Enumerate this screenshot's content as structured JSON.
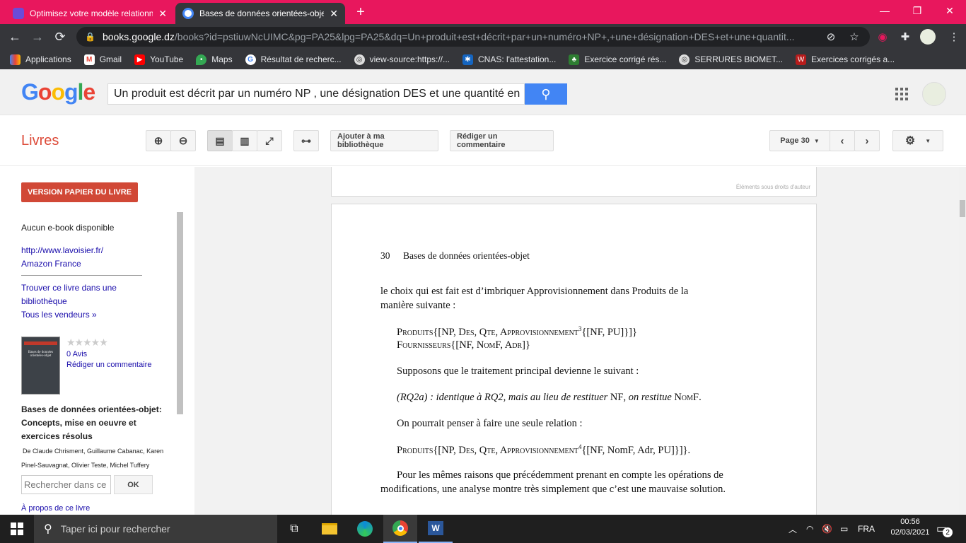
{
  "tabs": [
    {
      "title": "Optimisez votre modèle relationn",
      "close": "✕"
    },
    {
      "title": "Bases de données orientées-objet",
      "close": "✕"
    }
  ],
  "new_tab": "+",
  "window_controls": {
    "minimize": "—",
    "maximize": "❐",
    "close": "✕"
  },
  "address": {
    "host": "books.google.dz",
    "path": "/books?id=pstiuwNcUIMC&pg=PA25&lpg=PA25&dq=Un+produit+est+décrit+par+un+numéro+NP+,+une+désignation+DES+et+une+quantit..."
  },
  "bookmarks": [
    {
      "label": "Applications",
      "icon": "apps-grid-icon"
    },
    {
      "label": "Gmail",
      "icon": "gmail-icon"
    },
    {
      "label": "YouTube",
      "icon": "youtube-icon"
    },
    {
      "label": "Maps",
      "icon": "maps-icon"
    },
    {
      "label": "Résultat de recherc...",
      "icon": "google-icon"
    },
    {
      "label": "view-source:https://...",
      "icon": "globe-icon"
    },
    {
      "label": "CNAS: l'attestation...",
      "icon": "cnas-icon"
    },
    {
      "label": "Exercice corrigé rés...",
      "icon": "exercise-icon"
    },
    {
      "label": "SERRURES BIOMET...",
      "icon": "globe-icon"
    },
    {
      "label": "Exercices corrigés a...",
      "icon": "exercise2-icon"
    }
  ],
  "google": {
    "logo_letters": [
      "G",
      "o",
      "o",
      "g",
      "l",
      "e"
    ],
    "logo_colors": [
      "#4285f4",
      "#ea4335",
      "#fbbc05",
      "#4285f4",
      "#34a853",
      "#ea4335"
    ],
    "search_value": "Un produit est décrit par un numéro NP , une désignation DES et une quantité en"
  },
  "books_bar": {
    "title": "Livres",
    "add_library": "Ajouter à ma bibliothèque",
    "write_review": "Rédiger un commentaire",
    "page_select": "Page 30"
  },
  "sidebar": {
    "buy": "VERSION PAPIER DU LIVRE",
    "no_ebook": "Aucun e-book disponible",
    "link1": "http://www.lavoisier.fr/",
    "link2": "Amazon France",
    "find_lib_1": "Trouver ce livre dans une",
    "find_lib_2": "bibliothèque",
    "all_sellers": "Tous les vendeurs »",
    "stars": "★★★★★",
    "reviews": "0 Avis",
    "write_review": "Rédiger un commentaire",
    "cover_title": "Bases de données orientées-objet",
    "book_title_1": "Bases de données orientées-objet:",
    "book_title_2": "Concepts, mise en oeuvre et",
    "book_title_3": "exercices résolus",
    "authors_1": "De Claude Chrisment, Guillaume Cabanac, Karen",
    "authors_2": "Pinel-Sauvagnat, Olivier Teste, Michel Tuffery",
    "search_placeholder": "Rechercher dans ce",
    "ok": "OK",
    "about": "À propos de ce livre"
  },
  "page_prev": {
    "copyright": "Éléments sous droits d'auteur"
  },
  "page": {
    "number": "30",
    "running_title": "Bases de données orientées-objet",
    "p1_a": "le choix qui est fait est d’imbriquer Approvisionnement dans Produits de la",
    "p1_b": "manière suivante :",
    "s1": "Produits{[NP, Des, Qte, Approvisionnement",
    "s1_sup": "3",
    "s1_end": "{[NF, PU]}]}",
    "s2": "Fournisseurs{[NF, NomF, Adr]}",
    "p2": "Supposons que le traitement principal devienne le suivant :",
    "rq_a": "(RQ2a) : identique à RQ2, mais au lieu de restituer ",
    "rq_b": "NF",
    "rq_c": ", on restitue ",
    "rq_d": "NomF",
    "rq_e": ".",
    "p3": "On pourrait penser à faire une seule relation :",
    "s3": "Produits{[NP, Des, Qte, Approvisionnement",
    "s3_sup": "4",
    "s3_end": "{[NF, NomF, Adr, PU]}]}.",
    "p4_a": "Pour les mêmes raisons que précédemment prenant en compte les opérations de",
    "p4_b": "modifications, une analyse montre très simplement que c’est une mauvaise solution."
  },
  "taskbar": {
    "search_placeholder": "Taper ici pour rechercher",
    "lang": "FRA",
    "time": "00:56",
    "date": "02/03/2021",
    "notif_count": "2"
  }
}
